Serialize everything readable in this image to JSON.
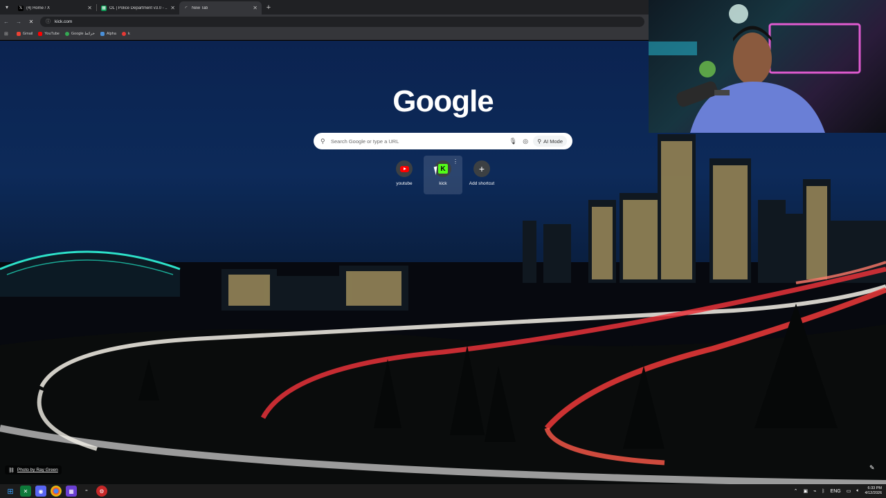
{
  "browser": {
    "tabs": [
      {
        "title": "(4) Home / X",
        "favicon": "x-logo-icon",
        "active": false
      },
      {
        "title": "OL | Police Department v3.0 - ...",
        "favicon": "spreadsheet-icon",
        "active": false
      },
      {
        "title": "New Tab",
        "favicon": "chrome-newtab-icon",
        "active": true
      }
    ],
    "address": "kick.com",
    "bookmarks": [
      {
        "label": "Gmail",
        "color": "#ea4335"
      },
      {
        "label": "YouTube",
        "color": "#ff0000"
      },
      {
        "label": "Google خرائط",
        "color": "#34a853"
      },
      {
        "label": "Alpha",
        "color": "#4a90d9"
      },
      {
        "label": "k",
        "color": "#e53935"
      }
    ]
  },
  "newtab": {
    "logo": "Google",
    "search_placeholder": "Search Google or type a URL",
    "ai_mode_label": "AI Mode",
    "shortcuts": [
      {
        "label": "youtube",
        "icon": "youtube-icon"
      },
      {
        "label": "kick",
        "icon": "kick-icon"
      },
      {
        "label": "Add shortcut",
        "icon": "plus-icon"
      }
    ],
    "photo_credit": "Photo by Ray Green"
  },
  "taskbar": {
    "language": "ENG",
    "time": "6:33 PM",
    "date": "4/12/2026"
  },
  "colors": {
    "kick_green": "#53fc18",
    "youtube_red": "#ff0000",
    "sky": "#0d2a59"
  }
}
